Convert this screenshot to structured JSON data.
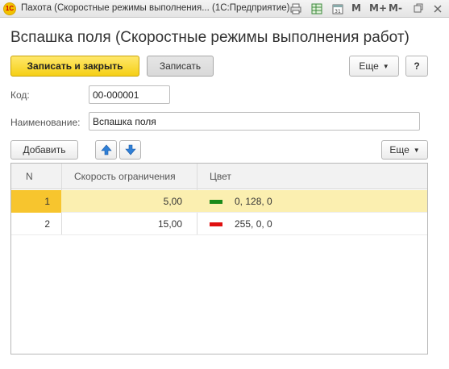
{
  "window": {
    "title": "Пахота (Скоростные режимы выполнения...  (1С:Предприятие)",
    "logo_text": "1C",
    "controls": {
      "m": "M",
      "m_plus": "M+",
      "m_minus": "M-"
    }
  },
  "form": {
    "title": "Вспашка поля (Скоростные режимы выполнения работ)",
    "save_close_label": "Записать и закрыть",
    "save_label": "Записать",
    "more_label": "Еще",
    "help_label": "?"
  },
  "fields": {
    "code_label": "Код:",
    "code_value": "00-000001",
    "name_label": "Наименование:",
    "name_value": "Вспашка поля"
  },
  "table_toolbar": {
    "add_label": "Добавить",
    "more_label": "Еще"
  },
  "table": {
    "columns": [
      "N",
      "Скорость ограничения",
      "Цвет"
    ],
    "rows": [
      {
        "n": "1",
        "speed": "5,00",
        "color_text": "0, 128, 0",
        "swatch": "#1a8a1a",
        "selected": true
      },
      {
        "n": "2",
        "speed": "15,00",
        "color_text": "255, 0, 0",
        "swatch": "#e01010",
        "selected": false
      }
    ]
  },
  "colors": {
    "primary_button": "#f5cf16",
    "selected_row": "#fbefb0",
    "selected_cell": "#f7c52e"
  },
  "icons": [
    "print-icon",
    "table-icon",
    "calendar-icon",
    "up-arrow-icon",
    "down-arrow-icon",
    "close-icon",
    "restore-icon",
    "menu-icon"
  ]
}
